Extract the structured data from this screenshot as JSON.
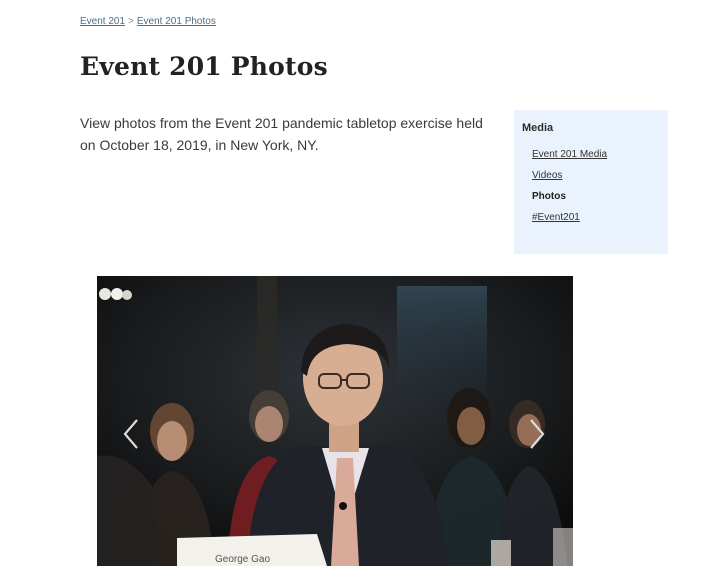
{
  "breadcrumb": {
    "items": [
      "Event 201",
      "Event 201 Photos"
    ],
    "separator": ">"
  },
  "page": {
    "title": "Event 201 Photos",
    "intro": "View photos from the Event 201 pandemic tabletop exercise held on October 18, 2019, in New York, NY."
  },
  "sidebar": {
    "title": "Media",
    "items": [
      {
        "label": "Event 201 Media",
        "active": false
      },
      {
        "label": "Videos",
        "active": false
      },
      {
        "label": "Photos",
        "active": true
      },
      {
        "label": "#Event201",
        "active": false
      }
    ]
  },
  "carousel": {
    "prev_icon": "chevron-left-icon",
    "next_icon": "chevron-right-icon",
    "nameplate_text": "George Gao"
  },
  "colors": {
    "sidebar_bg": "#eaf3fd",
    "link": "#4a6f8a"
  }
}
